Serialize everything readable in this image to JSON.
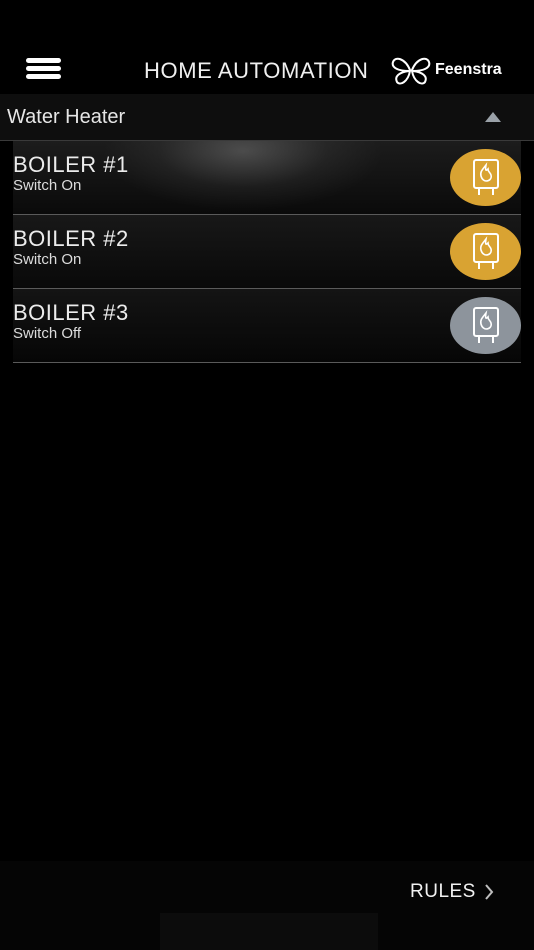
{
  "header": {
    "title": "HOME AUTOMATION",
    "brand": "Feenstra",
    "menu_icon": "hamburger-menu-icon",
    "logo_icon": "butterfly-logo-icon"
  },
  "section": {
    "title": "Water Heater",
    "state_icon": "triangle-up-icon"
  },
  "devices": [
    {
      "name": "BOILER #1",
      "status": "Switch On",
      "on": true
    },
    {
      "name": "BOILER #2",
      "status": "Switch On",
      "on": true
    },
    {
      "name": "BOILER #3",
      "status": "Switch Off",
      "on": false
    }
  ],
  "footer": {
    "rules_label": "RULES",
    "rules_icon": "chevron-right-icon"
  },
  "colors": {
    "background": "#000000",
    "on_accent": "#d9a332",
    "off_accent": "#8d949c",
    "text": "#e8e8e8"
  }
}
